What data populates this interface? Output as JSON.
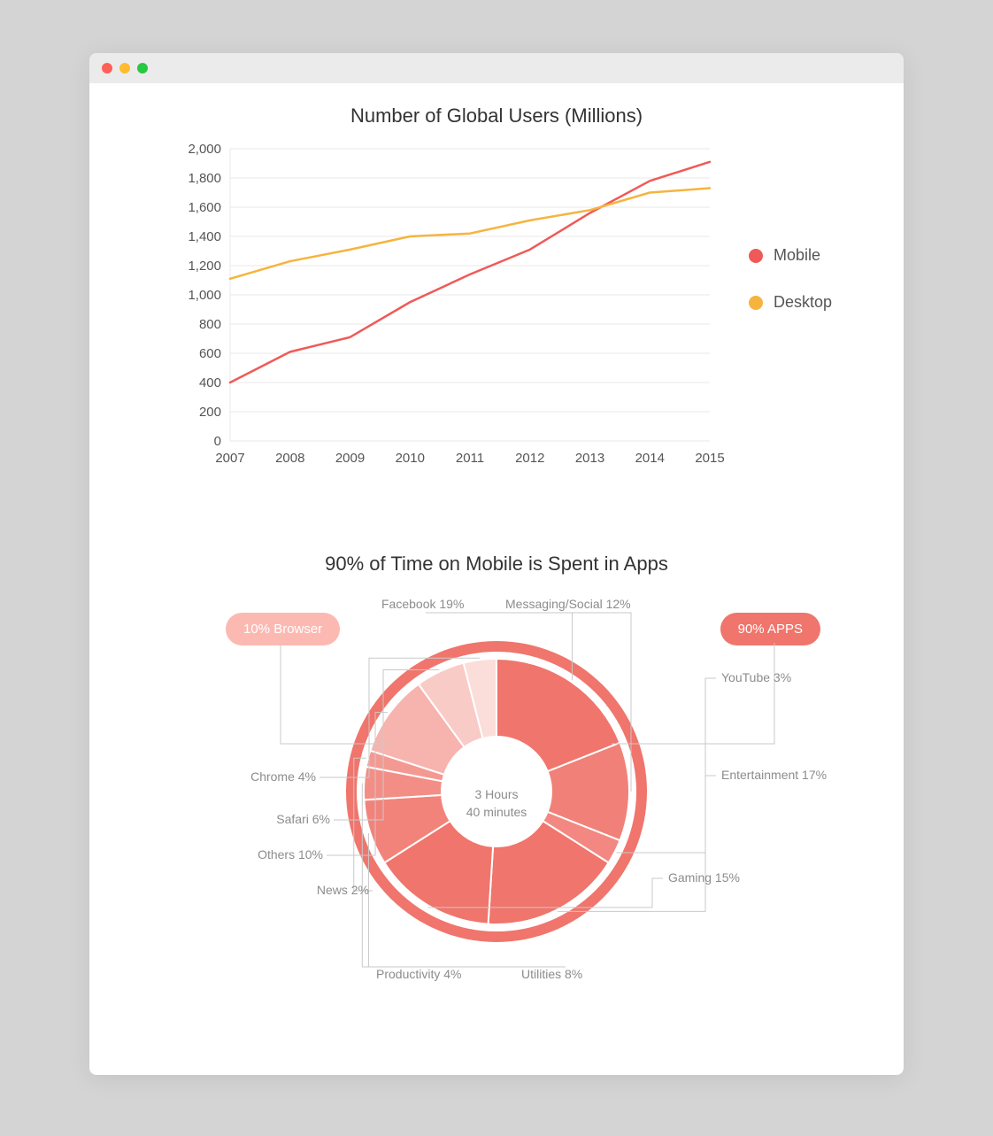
{
  "chart_data": [
    {
      "type": "line",
      "title": "Number of Global Users (Millions)",
      "categories": [
        "2007",
        "2008",
        "2009",
        "2010",
        "2011",
        "2012",
        "2013",
        "2014",
        "2015"
      ],
      "ylim": [
        0,
        2000
      ],
      "yticks": [
        0,
        200,
        400,
        600,
        800,
        1000,
        1200,
        1400,
        1600,
        1800,
        2000
      ],
      "series": [
        {
          "name": "Mobile",
          "color": "#ef5a58",
          "values": [
            400,
            610,
            710,
            950,
            1140,
            1310,
            1560,
            1780,
            1910
          ]
        },
        {
          "name": "Desktop",
          "color": "#f6b43e",
          "values": [
            1110,
            1230,
            1310,
            1400,
            1420,
            1510,
            1580,
            1700,
            1730
          ]
        }
      ]
    },
    {
      "type": "pie",
      "title": "90% of Time on Mobile is Spent in Apps",
      "center_label": "3 Hours\n40 minutes",
      "summary": [
        {
          "label": "10% Browser",
          "style": "light"
        },
        {
          "label": "90% APPS",
          "style": "dark"
        }
      ],
      "slices": [
        {
          "name": "Facebook",
          "value": 19,
          "group": "apps",
          "shade": 1.0
        },
        {
          "name": "Messaging/Social",
          "value": 12,
          "group": "apps",
          "shade": 0.92
        },
        {
          "name": "YouTube",
          "value": 3,
          "group": "apps",
          "shade": 0.86
        },
        {
          "name": "Entertainment",
          "value": 17,
          "group": "apps",
          "shade": 1.0
        },
        {
          "name": "Gaming",
          "value": 15,
          "group": "apps",
          "shade": 1.0
        },
        {
          "name": "Utilities",
          "value": 8,
          "group": "apps",
          "shade": 0.9
        },
        {
          "name": "Productivity",
          "value": 4,
          "group": "apps",
          "shade": 0.82
        },
        {
          "name": "News",
          "value": 2,
          "group": "apps",
          "shade": 0.74
        },
        {
          "name": "Others",
          "value": 10,
          "group": "apps",
          "shade": 0.55
        },
        {
          "name": "Safari",
          "value": 6,
          "group": "browser",
          "shade": 0.38
        },
        {
          "name": "Chrome",
          "value": 4,
          "group": "browser",
          "shade": 0.25
        }
      ]
    }
  ],
  "colors": {
    "mobile": "#ef5a58",
    "desktop": "#f6b43e",
    "pie_base": "#f0756c",
    "pie_outer": "#f0756c",
    "grid": "#e8e8e8",
    "axis_text": "#555"
  }
}
